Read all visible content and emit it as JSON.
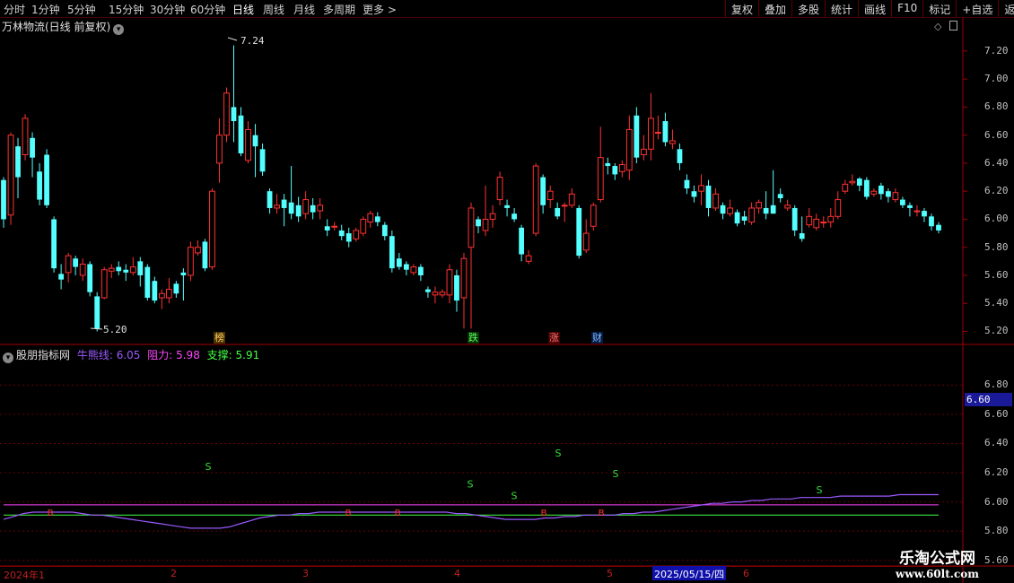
{
  "toolbar": {
    "periods": [
      "分时",
      "1分钟",
      "5分钟",
      "15分钟",
      "30分钟",
      "60分钟",
      "日线",
      "周线",
      "月线",
      "多周期",
      "更多"
    ],
    "active_period": "日线",
    "more_arrow": ">",
    "buttons": [
      "复权",
      "叠加",
      "多股",
      "统计",
      "画线",
      "F10",
      "标记",
      "+自选",
      "返回"
    ]
  },
  "main_panel": {
    "title": "万林物流(日线 前复权)",
    "high_label": "7.24",
    "low_label": "5.20",
    "y_ticks": [
      "7.20",
      "7.00",
      "6.80",
      "6.60",
      "6.40",
      "6.20",
      "6.00",
      "5.80",
      "5.60",
      "5.40",
      "5.20"
    ],
    "event_marks": [
      {
        "label": "榜",
        "color": "#ffcc66"
      },
      {
        "label": "跌",
        "color": "#66ff66"
      },
      {
        "label": "涨",
        "color": "#ff5555"
      },
      {
        "label": "财",
        "color": "#88bbff"
      }
    ]
  },
  "indicator_panel": {
    "name": "股朋指标网",
    "items": [
      {
        "label": "牛熊线: ",
        "value": "6.05",
        "color": "#9b59ff"
      },
      {
        "label": "阻力: ",
        "value": "5.98",
        "color": "#ff44ff"
      },
      {
        "label": "支撑: ",
        "value": "5.91",
        "color": "#44ff44"
      }
    ],
    "y_ticks": [
      "6.80",
      "6.60",
      "6.40",
      "6.20",
      "6.00",
      "5.80",
      "5.60"
    ],
    "current_price": "6.60",
    "signal_s": "S",
    "signal_b": "B"
  },
  "dates": {
    "labels": [
      "2024年1",
      "2",
      "3",
      "4",
      "5",
      "6"
    ],
    "highlight": "2025/05/15/四"
  },
  "watermark": {
    "line1": "乐淘公式网",
    "line2": "www.60lt.com"
  },
  "colors": {
    "up": "#ff3232",
    "down": "#54ffff",
    "bull_bear_line": "#9b59ff",
    "resistance": "#ff44ff",
    "support": "#44ff44",
    "grid": "#6a0000"
  },
  "chart_data": {
    "type": "candlestick",
    "y_range": [
      5.12,
      7.34
    ],
    "candles": [
      [
        6.28,
        6.0,
        6.3,
        5.94
      ],
      [
        6.03,
        6.6,
        6.62,
        5.96
      ],
      [
        6.52,
        6.3,
        6.58,
        6.15
      ],
      [
        6.46,
        6.72,
        6.75,
        6.42
      ],
      [
        6.58,
        6.44,
        6.62,
        6.3
      ],
      [
        6.34,
        6.14,
        6.4,
        6.1
      ],
      [
        6.46,
        6.1,
        6.5,
        6.08
      ],
      [
        6.0,
        5.65,
        6.02,
        5.62
      ],
      [
        5.61,
        5.57,
        5.68,
        5.5
      ],
      [
        5.62,
        5.74,
        5.76,
        5.55
      ],
      [
        5.72,
        5.66,
        5.74,
        5.6
      ],
      [
        5.6,
        5.68,
        5.72,
        5.56
      ],
      [
        5.68,
        5.48,
        5.7,
        5.45
      ],
      [
        5.45,
        5.22,
        5.48,
        5.2
      ],
      [
        5.44,
        5.64,
        5.66,
        5.43
      ],
      [
        5.63,
        5.65,
        5.68,
        5.58
      ],
      [
        5.66,
        5.63,
        5.7,
        5.6
      ],
      [
        5.64,
        5.62,
        5.68,
        5.56
      ],
      [
        5.62,
        5.66,
        5.73,
        5.6
      ],
      [
        5.7,
        5.6,
        5.73,
        5.52
      ],
      [
        5.66,
        5.44,
        5.68,
        5.42
      ],
      [
        5.56,
        5.42,
        5.59,
        5.4
      ],
      [
        5.44,
        5.47,
        5.5,
        5.36
      ],
      [
        5.44,
        5.5,
        5.58,
        5.4
      ],
      [
        5.54,
        5.47,
        5.56,
        5.44
      ],
      [
        5.62,
        5.6,
        5.65,
        5.42
      ],
      [
        5.6,
        5.8,
        5.84,
        5.56
      ],
      [
        5.76,
        5.8,
        5.85,
        5.74
      ],
      [
        5.84,
        5.65,
        5.86,
        5.63
      ],
      [
        5.66,
        6.2,
        6.22,
        5.64
      ],
      [
        6.4,
        6.6,
        6.72,
        6.26
      ],
      [
        6.6,
        6.9,
        6.94,
        6.55
      ],
      [
        6.8,
        6.7,
        7.24,
        6.55
      ],
      [
        6.74,
        6.47,
        6.8,
        6.45
      ],
      [
        6.42,
        6.64,
        6.7,
        6.4
      ],
      [
        6.6,
        6.52,
        6.68,
        6.3
      ],
      [
        6.5,
        6.34,
        6.54,
        6.31
      ],
      [
        6.2,
        6.08,
        6.22,
        6.04
      ],
      [
        6.08,
        6.1,
        6.18,
        6.04
      ],
      [
        6.14,
        6.08,
        6.18,
        5.95
      ],
      [
        6.12,
        6.04,
        6.38,
        6.0
      ],
      [
        6.1,
        6.02,
        6.16,
        5.98
      ],
      [
        6.04,
        6.14,
        6.2,
        6.0
      ],
      [
        6.1,
        6.05,
        6.15,
        6.0
      ],
      [
        6.06,
        6.1,
        6.15,
        6.0
      ],
      [
        5.95,
        5.92,
        6.0,
        5.88
      ],
      [
        5.95,
        5.95,
        5.98,
        5.92
      ],
      [
        5.92,
        5.88,
        5.96,
        5.85
      ],
      [
        5.9,
        5.84,
        5.94,
        5.8
      ],
      [
        5.86,
        5.92,
        5.94,
        5.84
      ],
      [
        5.9,
        6.0,
        6.02,
        5.88
      ],
      [
        5.98,
        6.04,
        6.06,
        5.94
      ],
      [
        6.02,
        5.98,
        6.05,
        5.95
      ],
      [
        5.96,
        5.88,
        5.98,
        5.85
      ],
      [
        5.88,
        5.65,
        5.92,
        5.62
      ],
      [
        5.72,
        5.66,
        5.76,
        5.64
      ],
      [
        5.68,
        5.64,
        5.7,
        5.6
      ],
      [
        5.62,
        5.66,
        5.68,
        5.6
      ],
      [
        5.66,
        5.6,
        5.68,
        5.56
      ],
      [
        5.5,
        5.48,
        5.52,
        5.44
      ],
      [
        5.46,
        5.48,
        5.52,
        5.4
      ],
      [
        5.46,
        5.48,
        5.5,
        5.44
      ],
      [
        5.46,
        5.64,
        5.68,
        5.4
      ],
      [
        5.6,
        5.42,
        5.64,
        5.34
      ],
      [
        5.44,
        5.72,
        5.76,
        5.22
      ],
      [
        5.8,
        6.08,
        6.12,
        5.22
      ],
      [
        6.0,
        5.95,
        6.02,
        5.9
      ],
      [
        5.92,
        6.0,
        6.24,
        5.88
      ],
      [
        6.0,
        6.04,
        6.1,
        5.94
      ],
      [
        6.14,
        6.3,
        6.34,
        6.1
      ],
      [
        6.1,
        6.08,
        6.14,
        6.02
      ],
      [
        6.04,
        6.0,
        6.08,
        5.98
      ],
      [
        5.94,
        5.75,
        5.96,
        5.7
      ],
      [
        5.7,
        5.74,
        5.78,
        5.68
      ],
      [
        5.9,
        6.38,
        6.4,
        5.88
      ],
      [
        6.3,
        6.1,
        6.32,
        6.04
      ],
      [
        6.14,
        6.2,
        6.24,
        6.08
      ],
      [
        6.08,
        6.02,
        6.12,
        6.0
      ],
      [
        6.1,
        6.1,
        6.12,
        5.98
      ],
      [
        6.1,
        6.18,
        6.22,
        6.08
      ],
      [
        6.08,
        5.74,
        6.1,
        5.72
      ],
      [
        5.78,
        5.9,
        6.0,
        5.76
      ],
      [
        5.95,
        6.1,
        6.12,
        5.92
      ],
      [
        6.14,
        6.44,
        6.66,
        6.12
      ],
      [
        6.4,
        6.38,
        6.44,
        6.32
      ],
      [
        6.38,
        6.32,
        6.4,
        6.28
      ],
      [
        6.34,
        6.39,
        6.42,
        6.3
      ],
      [
        6.35,
        6.64,
        6.74,
        6.28
      ],
      [
        6.74,
        6.44,
        6.8,
        6.4
      ],
      [
        6.46,
        6.5,
        6.6,
        6.42
      ],
      [
        6.5,
        6.72,
        6.9,
        6.42
      ],
      [
        6.62,
        6.62,
        6.74,
        6.57
      ],
      [
        6.7,
        6.55,
        6.76,
        6.52
      ],
      [
        6.54,
        6.56,
        6.64,
        6.5
      ],
      [
        6.5,
        6.4,
        6.54,
        6.35
      ],
      [
        6.28,
        6.22,
        6.32,
        6.18
      ],
      [
        6.2,
        6.16,
        6.24,
        6.12
      ],
      [
        6.2,
        6.24,
        6.32,
        6.1
      ],
      [
        6.24,
        6.08,
        6.28,
        6.02
      ],
      [
        6.08,
        6.18,
        6.22,
        6.06
      ],
      [
        6.1,
        6.04,
        6.12,
        6.0
      ],
      [
        6.04,
        6.08,
        6.14,
        6.02
      ],
      [
        6.05,
        5.97,
        6.07,
        5.95
      ],
      [
        6.02,
        5.99,
        6.06,
        5.96
      ],
      [
        5.98,
        6.08,
        6.12,
        5.96
      ],
      [
        6.08,
        6.12,
        6.14,
        6.04
      ],
      [
        6.08,
        6.04,
        6.2,
        6.0
      ],
      [
        6.1,
        6.04,
        6.35,
        6.04
      ],
      [
        6.18,
        6.15,
        6.22,
        6.12
      ],
      [
        6.08,
        6.1,
        6.14,
        6.06
      ],
      [
        6.08,
        5.92,
        6.1,
        5.88
      ],
      [
        5.9,
        5.86,
        6.02,
        5.84
      ],
      [
        5.96,
        6.02,
        6.08,
        5.94
      ],
      [
        5.94,
        6.0,
        6.04,
        5.92
      ],
      [
        5.98,
        5.98,
        6.02,
        5.94
      ],
      [
        5.98,
        6.02,
        6.08,
        5.94
      ],
      [
        6.02,
        6.14,
        6.2,
        6.0
      ],
      [
        6.2,
        6.25,
        6.28,
        6.18
      ],
      [
        6.26,
        6.27,
        6.32,
        6.24
      ],
      [
        6.29,
        6.24,
        6.3,
        6.2
      ],
      [
        6.28,
        6.16,
        6.3,
        6.14
      ],
      [
        6.18,
        6.2,
        6.22,
        6.16
      ],
      [
        6.24,
        6.18,
        6.26,
        6.14
      ],
      [
        6.2,
        6.16,
        6.22,
        6.12
      ],
      [
        6.14,
        6.19,
        6.22,
        6.12
      ],
      [
        6.14,
        6.1,
        6.16,
        6.08
      ],
      [
        6.1,
        6.08,
        6.12,
        6.02
      ],
      [
        6.06,
        6.06,
        6.1,
        6.02
      ],
      [
        6.06,
        6.02,
        6.08,
        5.98
      ],
      [
        6.02,
        5.95,
        6.04,
        5.92
      ],
      [
        5.96,
        5.92,
        5.98,
        5.9
      ]
    ],
    "indicator": {
      "y_range": [
        5.58,
        6.98
      ],
      "resistance_value": 5.98,
      "support_value": 5.91,
      "bull_bear_line": [
        5.88,
        5.9,
        5.92,
        5.93,
        5.93,
        5.93,
        5.93,
        5.93,
        5.92,
        5.91,
        5.91,
        5.9,
        5.89,
        5.88,
        5.87,
        5.86,
        5.85,
        5.84,
        5.83,
        5.82,
        5.82,
        5.82,
        5.82,
        5.83,
        5.85,
        5.87,
        5.89,
        5.9,
        5.91,
        5.91,
        5.92,
        5.92,
        5.93,
        5.93,
        5.93,
        5.93,
        5.93,
        5.93,
        5.93,
        5.93,
        5.93,
        5.93,
        5.93,
        5.93,
        5.93,
        5.93,
        5.92,
        5.92,
        5.91,
        5.9,
        5.89,
        5.88,
        5.88,
        5.88,
        5.88,
        5.89,
        5.89,
        5.9,
        5.9,
        5.91,
        5.91,
        5.91,
        5.91,
        5.92,
        5.92,
        5.93,
        5.93,
        5.94,
        5.95,
        5.96,
        5.97,
        5.98,
        5.99,
        5.99,
        6.0,
        6.0,
        6.01,
        6.01,
        6.02,
        6.02,
        6.02,
        6.03,
        6.03,
        6.03,
        6.03,
        6.04,
        6.04,
        6.04,
        6.04,
        6.04,
        6.04,
        6.05,
        6.05,
        6.05,
        6.05,
        6.05
      ],
      "sell_signals": [
        [
          232,
          6.22
        ],
        [
          524,
          6.1
        ],
        [
          573,
          6.02
        ],
        [
          622,
          6.31
        ],
        [
          686,
          6.17
        ],
        [
          913,
          6.06
        ]
      ],
      "buy_signals": [
        [
          56,
          5.93
        ],
        [
          388,
          5.93
        ],
        [
          443,
          5.93
        ],
        [
          606,
          5.93
        ],
        [
          670,
          5.93
        ]
      ]
    }
  }
}
